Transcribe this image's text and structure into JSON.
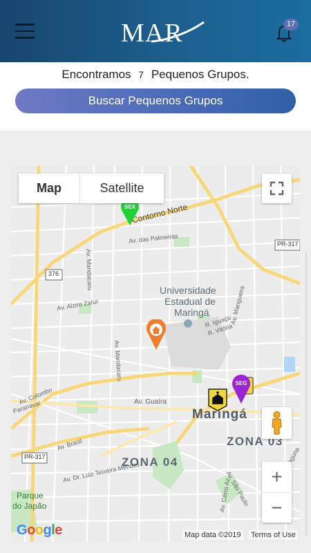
{
  "header": {
    "logo_text": "MAR",
    "notification_count": "17",
    "menu_icon": "hamburger-menu-icon",
    "bell_icon": "bell-icon"
  },
  "summary": {
    "prefix": "Encontramos",
    "count": "7",
    "suffix": "Pequenos Grupos.",
    "search_button": "Buscar Pequenos Grupos"
  },
  "map": {
    "type_map": "Map",
    "type_satellite": "Satellite",
    "zoom_in": "+",
    "zoom_out": "−",
    "attribution": "Map data ©2019",
    "terms": "Terms of Use",
    "google_logo": [
      "G",
      "o",
      "o",
      "g",
      "l",
      "e"
    ],
    "labels": {
      "contorno_norte": "Contorno Norte",
      "av_palmeiras": "Av. das Palmeiras",
      "av_mandacaru_n": "Av. Mandacaru",
      "av_mandacaru_s": "Av. Mandacaru",
      "univ_1": "Universidade",
      "univ_2": "Estadual de",
      "univ_3": "Maringá",
      "r_iguacu": "R. Iguaçu",
      "r_vitoria": "R. Vitória",
      "av_mangueira": "Av. Mangueira",
      "av_alziro": "Av. Alziro Zarur",
      "av_colombo": "Av. Colombo",
      "paranavai": "Paranavaí",
      "av_guaira": "Av. Guaíra",
      "maringa": "Maringá",
      "zona03": "ZONA 03",
      "zona04": "ZONA 04",
      "av_brasil": "Av. Brasil",
      "av_luiz": "Av. Dr. Luiz Teixeira Mendes",
      "av_sao_paulo": "Av. São Paulo",
      "av_cerro": "Av. Cerro Az",
      "parque_1": "Parque",
      "parque_2": "do Japão",
      "pr317_a": "PR-317",
      "pr317_b": "PR-317",
      "r376": "376",
      "aguna": "aguna"
    },
    "markers": {
      "sex": "SEX",
      "seg": "SEG"
    },
    "colors": {
      "road_major": "#f8d77b",
      "road_minor": "#ffffff",
      "park": "#c8e8c4",
      "marker_green": "#22d13a",
      "marker_orange": "#f07d2c",
      "marker_purple": "#9b25d4",
      "marker_yellow": "#f1d63c"
    }
  }
}
